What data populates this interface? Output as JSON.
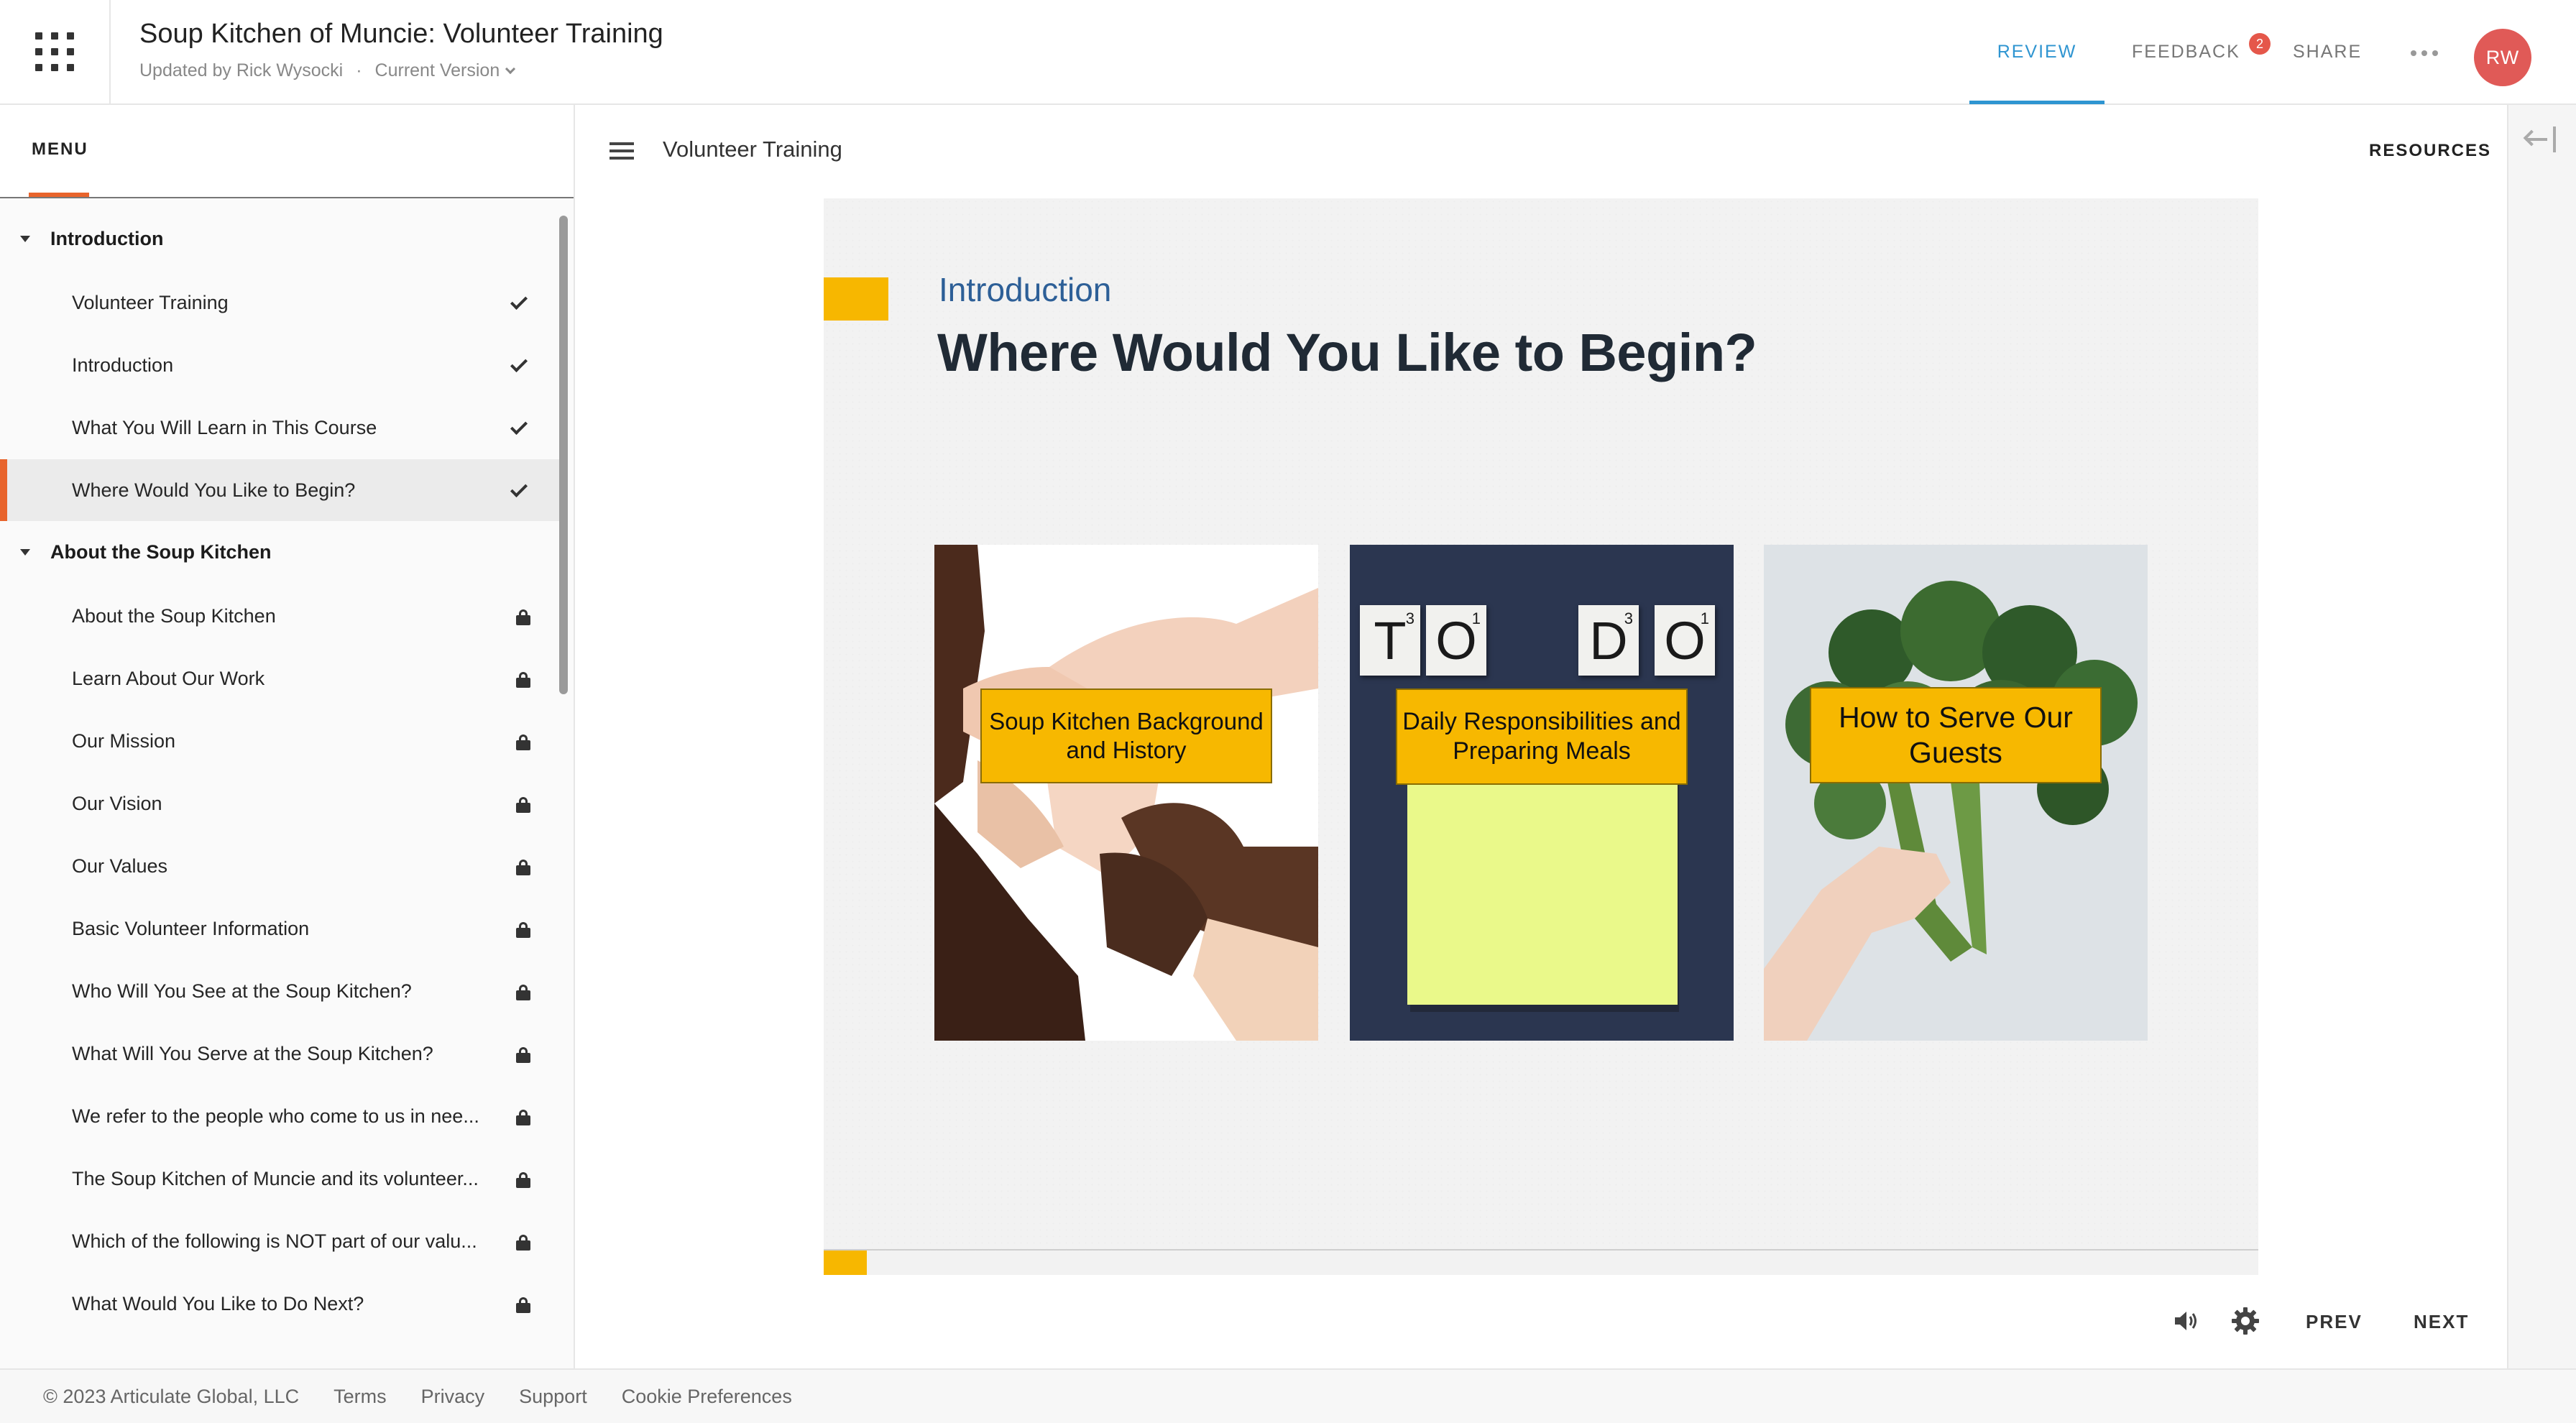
{
  "header": {
    "title": "Soup Kitchen of Muncie: Volunteer Training",
    "updated_by": "Updated by Rick Wysocki",
    "separator": "·",
    "version": "Current Version",
    "nav": {
      "review": "REVIEW",
      "feedback": "FEEDBACK",
      "feedback_count": "2",
      "share": "SHARE"
    },
    "avatar_initials": "RW",
    "accent_color": "#2f95d1"
  },
  "sidebar": {
    "menu_label": "MENU",
    "sections": [
      {
        "title": "Introduction",
        "items": [
          {
            "label": "Volunteer Training",
            "status": "complete"
          },
          {
            "label": "Introduction",
            "status": "complete"
          },
          {
            "label": "What You Will Learn in This Course",
            "status": "complete"
          },
          {
            "label": "Where Would You Like to Begin?",
            "status": "complete",
            "active": true
          }
        ]
      },
      {
        "title": "About the Soup Kitchen",
        "items": [
          {
            "label": "About the Soup Kitchen",
            "status": "locked"
          },
          {
            "label": "Learn About Our Work",
            "status": "locked"
          },
          {
            "label": "Our Mission",
            "status": "locked"
          },
          {
            "label": "Our Vision",
            "status": "locked"
          },
          {
            "label": "Our Values",
            "status": "locked"
          },
          {
            "label": "Basic Volunteer Information",
            "status": "locked"
          },
          {
            "label": "Who Will You See at the Soup Kitchen?",
            "status": "locked"
          },
          {
            "label": "What Will You Serve at the Soup Kitchen?",
            "status": "locked"
          },
          {
            "label": "We refer to the people who come to us in nee...",
            "status": "locked"
          },
          {
            "label": "The Soup Kitchen of Muncie and its volunteer...",
            "status": "locked"
          },
          {
            "label": "Which of the following is NOT part of our valu...",
            "status": "locked"
          },
          {
            "label": "What Would You Like to Do Next?",
            "status": "locked"
          }
        ]
      }
    ]
  },
  "main": {
    "lesson_title": "Volunteer Training",
    "resources_label": "RESOURCES",
    "slide": {
      "kicker": "Introduction",
      "title": "Where Would You Like to Begin?",
      "cards": [
        {
          "label": "Soup Kitchen Background and History",
          "image": "linked-hands-photo"
        },
        {
          "label": "Daily Responsibilities and Preparing Meals",
          "image": "to-do-tiles-sticky-note-photo"
        },
        {
          "label": "How to Serve Our Guests",
          "image": "hand-holding-broccoli-photo"
        }
      ],
      "todo_tiles": [
        {
          "letter": "T",
          "value": "3"
        },
        {
          "letter": "O",
          "value": "1"
        },
        {
          "letter": "D",
          "value": "3"
        },
        {
          "letter": "O",
          "value": "1"
        }
      ],
      "progress_fraction": 0.03,
      "accent_color": "#f7b700"
    },
    "controls": {
      "prev": "PREV",
      "next": "NEXT"
    }
  },
  "footer": {
    "copyright": "© 2023 Articulate Global, LLC",
    "links": [
      "Terms",
      "Privacy",
      "Support",
      "Cookie Preferences"
    ]
  }
}
